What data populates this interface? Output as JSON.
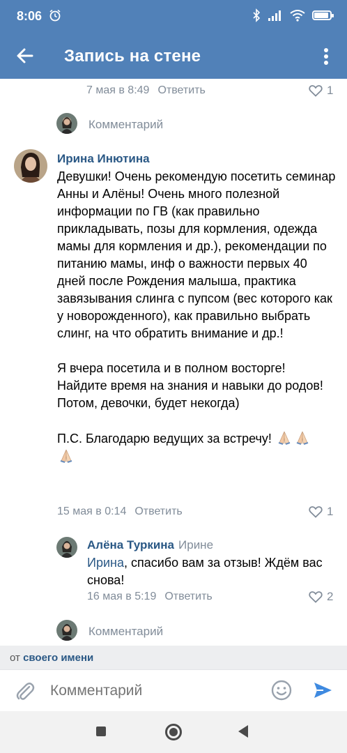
{
  "status_bar": {
    "time": "8:06",
    "icons": [
      "alarm-icon",
      "bluetooth-icon",
      "signal-icon",
      "wifi-icon",
      "battery-icon"
    ],
    "battery_level": 0.9
  },
  "app_bar": {
    "title": "Запись на стене",
    "back_icon": "arrow-left-icon",
    "menu_icon": "more-vertical-icon"
  },
  "colors": {
    "header": "#5181b8",
    "link": "#2a5885",
    "meta": "#818c99",
    "send": "#3f8ae0",
    "from_bar": "#edeef0"
  },
  "thread": {
    "prev_meta": {
      "date": "7 мая в 8:49",
      "reply": "Ответить",
      "likes": "1"
    },
    "prompt_1": "Комментарий",
    "comment": {
      "author": "Ирина Инютина",
      "text": "Девушки! Очень рекомендую посетить семинар Анны и Алёны! Очень много полезной информации по ГВ (как правильно прикладывать, позы для кормления, одежда мамы для кормления и др.), рекомендации по питанию мамы, инф о важности первых 40 дней после Рождения малыша, практика завязывания слинга с пупсом (вес которого как у новорожденного), как правильно выбрать слинг, на что обратить внимание и др.!",
      "text_2": "Я вчера посетила и в полном восторге! Найдите время на знания и навыки до родов! Потом, девочки, будет некогда)",
      "text_3": "П.С. Благодарю ведущих за встречу!",
      "emoji": "folded-hands-icon",
      "date": "15 мая в 0:14",
      "reply": "Ответить",
      "likes": "1"
    },
    "reply": {
      "author": "Алёна Туркина",
      "to": "Ирине",
      "mention": "Ирина",
      "text": ", спасибо вам за отзыв! Ждём вас снова!",
      "date": "16 мая в 5:19",
      "reply": "Ответить",
      "likes": "2"
    },
    "prompt_2": "Комментарий"
  },
  "from_bar": {
    "prefix": "от",
    "who": "своего имени"
  },
  "input": {
    "placeholder": "Комментарий"
  }
}
